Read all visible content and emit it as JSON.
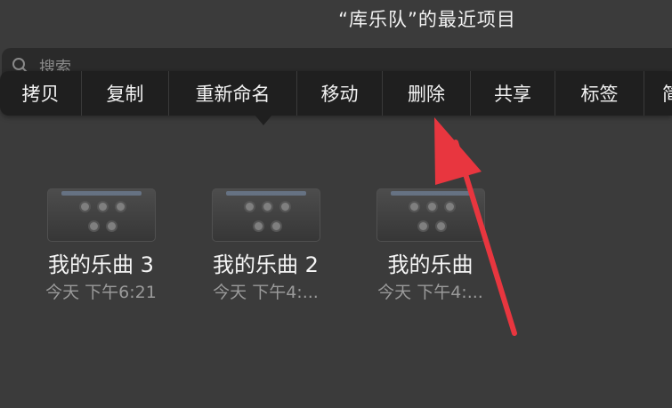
{
  "title": "“库乐队”的最近项目",
  "search": {
    "placeholder": "搜索"
  },
  "context_menu": {
    "items": [
      {
        "label": "拷贝"
      },
      {
        "label": "复制"
      },
      {
        "label": "重新命名"
      },
      {
        "label": "移动"
      },
      {
        "label": "删除"
      },
      {
        "label": "共享"
      },
      {
        "label": "标签"
      },
      {
        "label": "简"
      }
    ]
  },
  "files": [
    {
      "name": "我的乐曲 3",
      "date": "今天 下午6:21"
    },
    {
      "name": "我的乐曲 2",
      "date": "今天 下午4:..."
    },
    {
      "name": "我的乐曲",
      "date": "今天 下午4:..."
    }
  ],
  "annotation": {
    "color": "#e8363f",
    "target": "删除"
  }
}
